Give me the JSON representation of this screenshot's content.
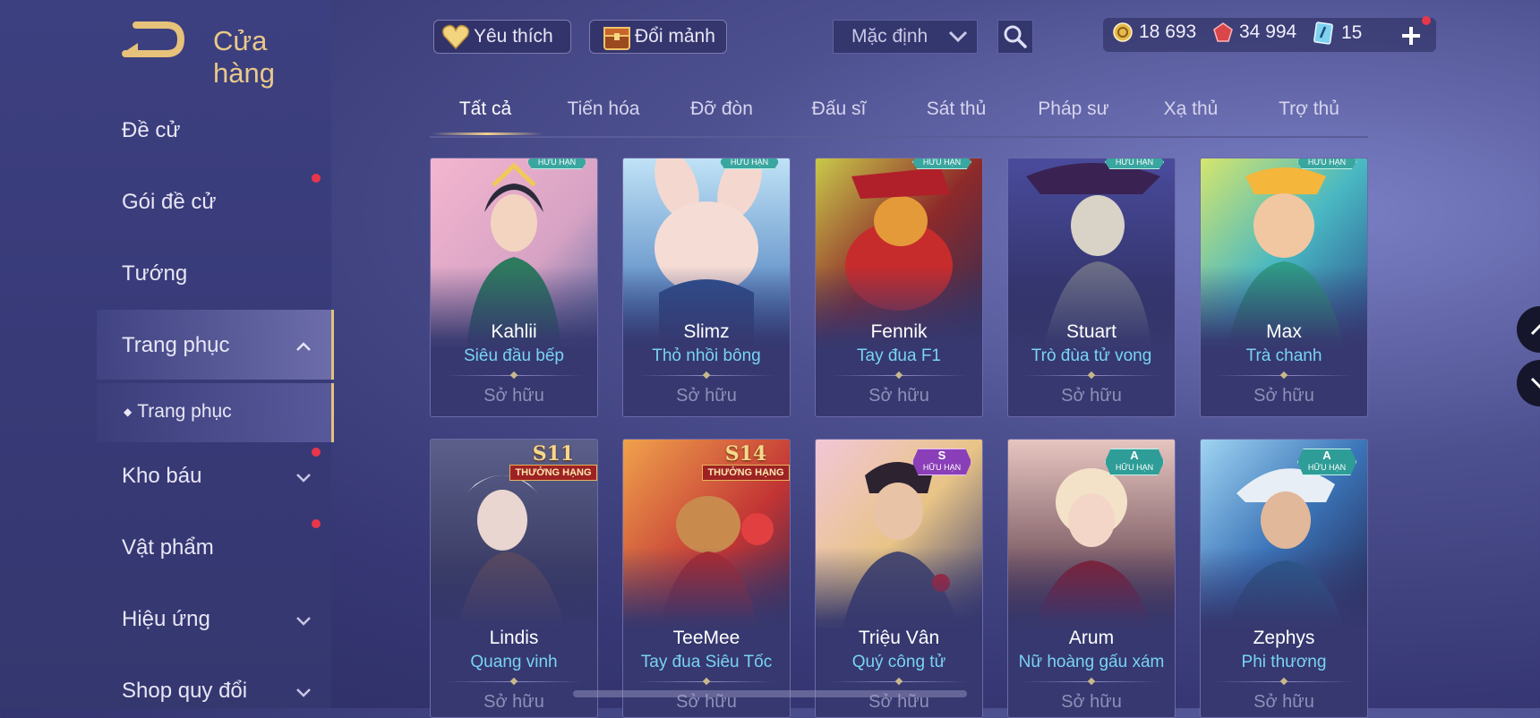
{
  "header": {
    "title": "Cửa hàng"
  },
  "sidebar": {
    "items": [
      {
        "label": "Đề cử"
      },
      {
        "label": "Gói đề cử"
      },
      {
        "label": "Tướng"
      },
      {
        "label": "Trang phục"
      },
      {
        "label": "Kho báu"
      },
      {
        "label": "Vật phẩm"
      },
      {
        "label": "Hiệu ứng"
      },
      {
        "label": "Shop quy đổi"
      }
    ],
    "sub_item": "Trang phục"
  },
  "toolbar": {
    "favorites_label": "Yêu thích",
    "exchange_label": "Đổi mảnh",
    "sort_value": "Mặc định"
  },
  "currency": {
    "gold": "18 693",
    "vouchers": "34 994",
    "tickets": "15"
  },
  "tabs": [
    "Tất cả",
    "Tiến hóa",
    "Đỡ đòn",
    "Đấu sĩ",
    "Sát thủ",
    "Pháp sư",
    "Xạ thủ",
    "Trợ thủ"
  ],
  "cards_row1": [
    {
      "hero": "Kahlii",
      "skin": "Siêu đầu bếp",
      "status": "Sở hữu",
      "badge": "HỮU HẠN"
    },
    {
      "hero": "Slimz",
      "skin": "Thỏ nhồi bông",
      "status": "Sở hữu",
      "badge": "HỮU HẠN"
    },
    {
      "hero": "Fennik",
      "skin": "Tay đua F1",
      "status": "Sở hữu",
      "badge": "HỮU HẠN"
    },
    {
      "hero": "Stuart",
      "skin": "Trò đùa tử vong",
      "status": "Sở hữu",
      "badge": "HỮU HẠN"
    },
    {
      "hero": "Max",
      "skin": "Trà chanh",
      "status": "Sở hữu",
      "badge": "HỮU HẠN"
    }
  ],
  "cards_row2": [
    {
      "hero": "Lindis",
      "skin": "Quang vinh",
      "status": "Sở hữu",
      "season": "S11",
      "rank": "THƯỞNG HẠNG"
    },
    {
      "hero": "TeeMee",
      "skin": "Tay đua Siêu Tốc",
      "status": "Sở hữu",
      "season": "S14",
      "rank": "THƯỞNG HẠNG"
    },
    {
      "hero": "Triệu Vân",
      "skin": "Quý công tử",
      "status": "Sở hữu",
      "grade": "S",
      "grade_label": "HỮU HẠN"
    },
    {
      "hero": "Arum",
      "skin": "Nữ hoàng gấu xám",
      "status": "Sở hữu",
      "grade": "A",
      "grade_label": "HỮU HẠN"
    },
    {
      "hero": "Zephys",
      "skin": "Phi thương",
      "status": "Sở hữu",
      "grade": "A",
      "grade_label": "HỮU HẠN"
    }
  ],
  "colors": {
    "gold_accent": "#e8c98a",
    "skin_name": "#79d3f5",
    "notification": "#e8364a"
  }
}
